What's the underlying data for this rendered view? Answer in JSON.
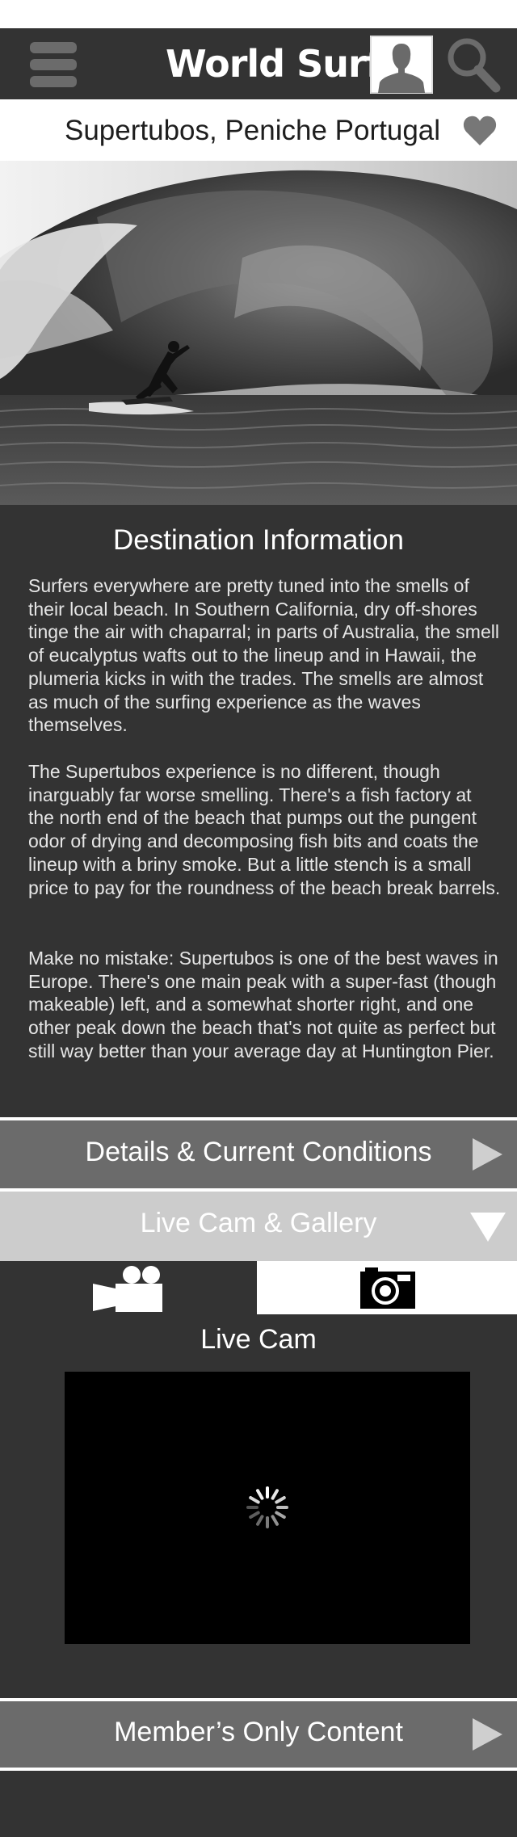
{
  "header": {
    "title": "World Surf",
    "menu_icon": "hamburger-menu-icon",
    "profile_icon": "user-avatar-icon",
    "search_icon": "search-icon"
  },
  "location": {
    "title": "Supertubos, Peniche Portugal",
    "favorite_icon": "heart-icon"
  },
  "destination": {
    "heading": "Destination Information",
    "paragraphs": [
      "Surfers everywhere are pretty tuned into the smells of their local beach. In Southern California, dry off-shores tinge the air with chaparral; in parts of Australia, the smell of eucalyptus wafts out to the lineup and in Hawaii, the plumeria kicks in with the trades. The smells are almost as much of the surfing experience as the waves themselves.",
      "The Supertubos experience is no different, though inarguably far worse smelling. There's a fish factory at the north end of the beach that pumps out the pungent odor of drying and decomposing fish bits and coats the lineup with a briny smoke. But a little stench is a small price to pay for the roundness of the beach break barrels.",
      "Make no mistake: Supertubos is one of the best waves in Europe. There's one main peak with a super-fast (though makeable) left, and a somewhat shorter right, and one other peak down the beach that's not quite as perfect but still way better than your average day at Huntington Pier."
    ]
  },
  "sections": {
    "details": {
      "label": "Details & Current Conditions",
      "icon": "triangle-right-icon"
    },
    "gallery": {
      "label": "Live Cam & Gallery",
      "icon": "triangle-down-icon"
    },
    "members": {
      "label": "Member’s Only Content",
      "icon": "triangle-right-icon"
    }
  },
  "gallery": {
    "tabs": [
      {
        "icon": "video-camera-icon",
        "selected": false
      },
      {
        "icon": "photo-camera-icon",
        "selected": true
      }
    ],
    "live_label": "Live Cam",
    "loading_icon": "loading-spinner-icon"
  },
  "colors": {
    "dark": "#333333",
    "mid_gray": "#6b6b6b",
    "light_gray": "#cccccc",
    "white": "#ffffff"
  }
}
